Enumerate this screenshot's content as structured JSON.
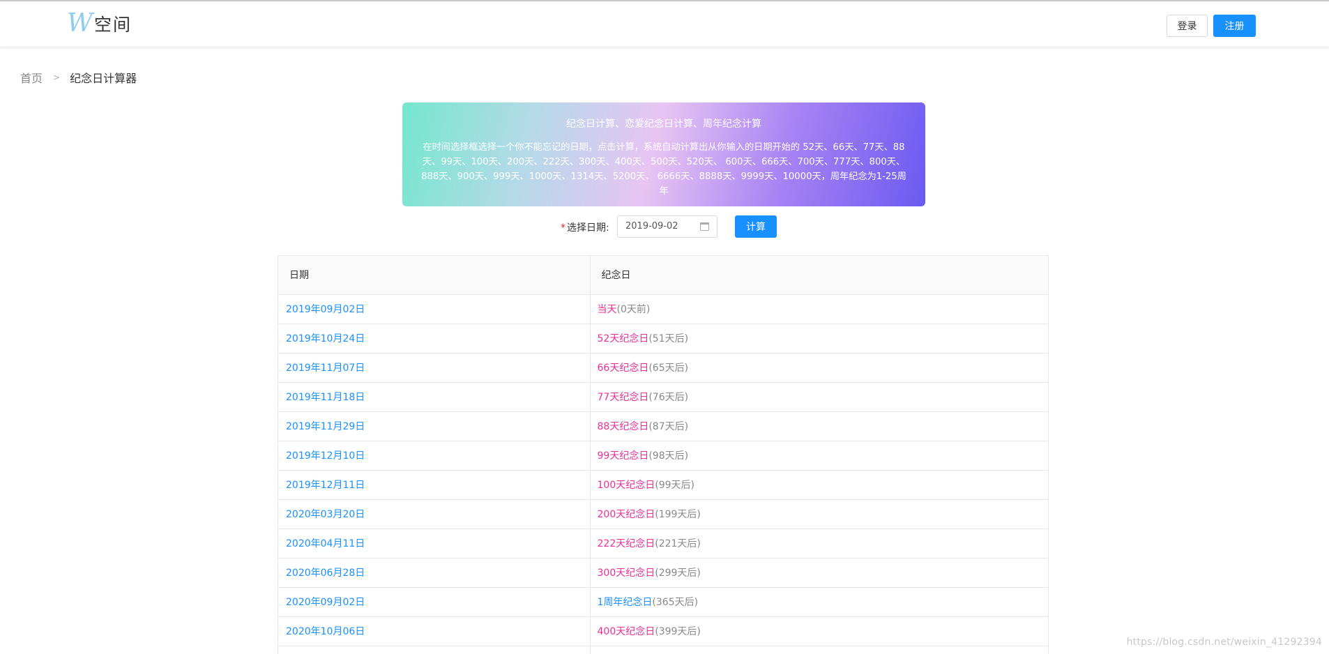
{
  "header": {
    "logo_letter": "W",
    "logo_text": "空间",
    "login_label": "登录",
    "register_label": "注册"
  },
  "breadcrumb": {
    "home": "首页",
    "separator": ">",
    "current": "纪念日计算器"
  },
  "banner": {
    "title": "纪念日计算、恋爱纪念日计算、周年纪念计算",
    "description": "在时间选择框选择一个你不能忘记的日期，点击计算，系统自动计算出从你输入的日期开始的 52天、66天、77天、88天、99天、100天、200天、222天、300天、400天、500天、520天、 600天、666天、700天、777天、800天、888天、900天、999天、1000天、1314天、5200天、 6666天、8888天、9999天、10000天，周年纪念为1-25周年"
  },
  "form": {
    "required_mark": "*",
    "label": "选择日期:",
    "date_value": "2019-09-02",
    "calc_label": "计算"
  },
  "table": {
    "columns": [
      "日期",
      "纪念日"
    ],
    "rows": [
      {
        "date": "2019年09月02日",
        "name": "当天",
        "days": "(0天前)",
        "highlight": "pink"
      },
      {
        "date": "2019年10月24日",
        "name": "52天纪念日",
        "days": "(51天后)",
        "highlight": "pink"
      },
      {
        "date": "2019年11月07日",
        "name": "66天纪念日",
        "days": "(65天后)",
        "highlight": "pink"
      },
      {
        "date": "2019年11月18日",
        "name": "77天纪念日",
        "days": "(76天后)",
        "highlight": "pink"
      },
      {
        "date": "2019年11月29日",
        "name": "88天纪念日",
        "days": "(87天后)",
        "highlight": "pink"
      },
      {
        "date": "2019年12月10日",
        "name": "99天纪念日",
        "days": "(98天后)",
        "highlight": "pink"
      },
      {
        "date": "2019年12月11日",
        "name": "100天纪念日",
        "days": "(99天后)",
        "highlight": "pink"
      },
      {
        "date": "2020年03月20日",
        "name": "200天纪念日",
        "days": "(199天后)",
        "highlight": "pink"
      },
      {
        "date": "2020年04月11日",
        "name": "222天纪念日",
        "days": "(221天后)",
        "highlight": "pink"
      },
      {
        "date": "2020年06月28日",
        "name": "300天纪念日",
        "days": "(299天后)",
        "highlight": "pink"
      },
      {
        "date": "2020年09月02日",
        "name": "1周年纪念日",
        "days": "(365天后)",
        "highlight": "blue"
      },
      {
        "date": "2020年10月06日",
        "name": "400天纪念日",
        "days": "(399天后)",
        "highlight": "pink"
      },
      {
        "date": "",
        "name": "",
        "days": "",
        "highlight": "pink"
      }
    ]
  },
  "watermark": "https://blog.csdn.net/weixin_41292394",
  "colors": {
    "primary": "#1890ff",
    "pink": "#eb2f96",
    "logo": "#8fcdef"
  }
}
